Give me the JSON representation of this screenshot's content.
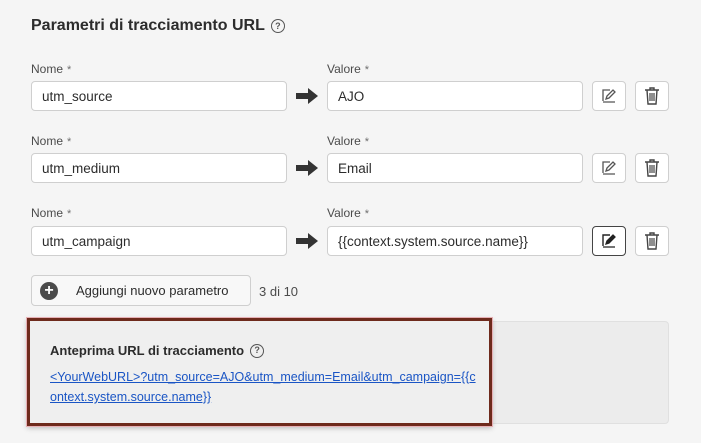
{
  "section": {
    "title": "Parametri di tracciamento URL"
  },
  "labels": {
    "name": "Nome",
    "value": "Valore",
    "required_mark": "*"
  },
  "params": [
    {
      "name": "utm_source",
      "value": "AJO"
    },
    {
      "name": "utm_medium",
      "value": "Email"
    },
    {
      "name": "utm_campaign",
      "value": "{{context.system.source.name}}"
    }
  ],
  "add_button": {
    "label": "Aggiungi nuovo parametro"
  },
  "counter": "3 di 10",
  "preview": {
    "title": "Anteprima URL di tracciamento",
    "url": "<YourWebURL>?utm_source=AJO&utm_medium=Email&utm_campaign={{context.system.source.name}}"
  },
  "icons": {
    "help": "help-circle-icon",
    "arrow": "arrow-right-icon",
    "edit": "edit-icon",
    "delete": "trash-icon",
    "add": "add-circle-icon"
  }
}
